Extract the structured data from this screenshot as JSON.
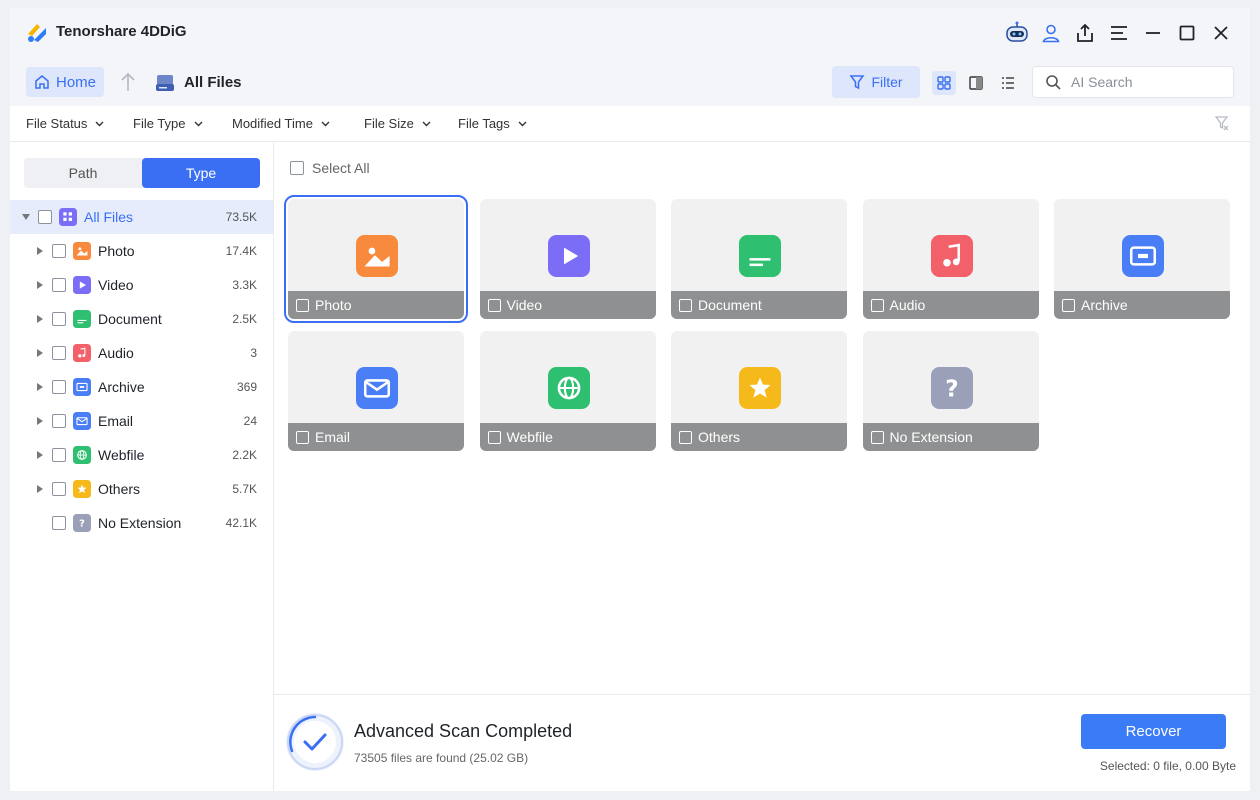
{
  "app": {
    "title": "Tenorshare 4DDiG"
  },
  "titlebar": {
    "icons": [
      "robot-assistant-icon",
      "user-icon",
      "share-icon",
      "menu-icon",
      "minimize-icon",
      "maximize-icon",
      "close-icon"
    ]
  },
  "nav": {
    "home_label": "Home",
    "location_title": "All Files",
    "filter_label": "Filter",
    "search_placeholder": "AI Search"
  },
  "filters": [
    "File Status",
    "File Type",
    "Modified Time",
    "File Size",
    "File Tags"
  ],
  "sidebar": {
    "tabs": {
      "path": "Path",
      "type": "Type"
    },
    "items": [
      {
        "label": "All Files",
        "count": "73.5K",
        "icon": "grid-icon",
        "color": "#7b6df6"
      },
      {
        "label": "Photo",
        "count": "17.4K",
        "icon": "photo-icon",
        "color": "#f78a3c"
      },
      {
        "label": "Video",
        "count": "3.3K",
        "icon": "video-icon",
        "color": "#7b6df6"
      },
      {
        "label": "Document",
        "count": "2.5K",
        "icon": "document-icon",
        "color": "#2fbf71"
      },
      {
        "label": "Audio",
        "count": "3",
        "icon": "audio-icon",
        "color": "#f2616a"
      },
      {
        "label": "Archive",
        "count": "369",
        "icon": "archive-icon",
        "color": "#4a7ef6"
      },
      {
        "label": "Email",
        "count": "24",
        "icon": "email-icon",
        "color": "#4a7ef6"
      },
      {
        "label": "Webfile",
        "count": "2.2K",
        "icon": "webfile-icon",
        "color": "#2fbf71"
      },
      {
        "label": "Others",
        "count": "5.7K",
        "icon": "others-icon",
        "color": "#f6b91c"
      },
      {
        "label": "No Extension",
        "count": "42.1K",
        "icon": "no-extension-icon",
        "color": "#9aa0b8"
      }
    ]
  },
  "main": {
    "select_all": "Select All",
    "tiles": [
      {
        "label": "Photo",
        "icon": "photo-icon",
        "color": "#f78a3c"
      },
      {
        "label": "Video",
        "icon": "video-icon",
        "color": "#7b6df6"
      },
      {
        "label": "Document",
        "icon": "document-icon",
        "color": "#2fbf71"
      },
      {
        "label": "Audio",
        "icon": "audio-icon",
        "color": "#f2616a"
      },
      {
        "label": "Archive",
        "icon": "archive-icon",
        "color": "#4a7ef6"
      },
      {
        "label": "Email",
        "icon": "email-icon",
        "color": "#4a7ef6"
      },
      {
        "label": "Webfile",
        "icon": "webfile-icon",
        "color": "#2fbf71"
      },
      {
        "label": "Others",
        "icon": "others-icon",
        "color": "#f6b91c"
      },
      {
        "label": "No Extension",
        "icon": "no-extension-icon",
        "color": "#9aa0b8"
      }
    ]
  },
  "footer": {
    "scan_title": "Advanced Scan Completed",
    "scan_summary": "73505 files are found (25.02 GB)",
    "recover_label": "Recover",
    "selected_info": "Selected: 0 file, 0.00 Byte"
  },
  "colors": {
    "accent": "#3a6ff4",
    "tile_bar": "#8f9091"
  }
}
